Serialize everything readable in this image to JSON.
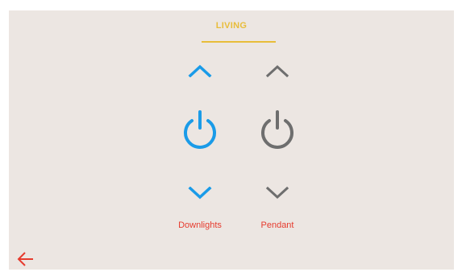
{
  "header": {
    "title": "LIVING"
  },
  "channels": [
    {
      "label": "Downlights",
      "color": "#1a9be8",
      "state": "active"
    },
    {
      "label": "Pendant",
      "color": "#6e6e6e",
      "state": "inactive"
    }
  ],
  "nav": {
    "back_icon": "arrow-left-icon",
    "back_color": "#e63b2e"
  },
  "colors": {
    "background": "#ece6e2",
    "accent": "#e8bd3a",
    "label": "#e63b2e"
  }
}
